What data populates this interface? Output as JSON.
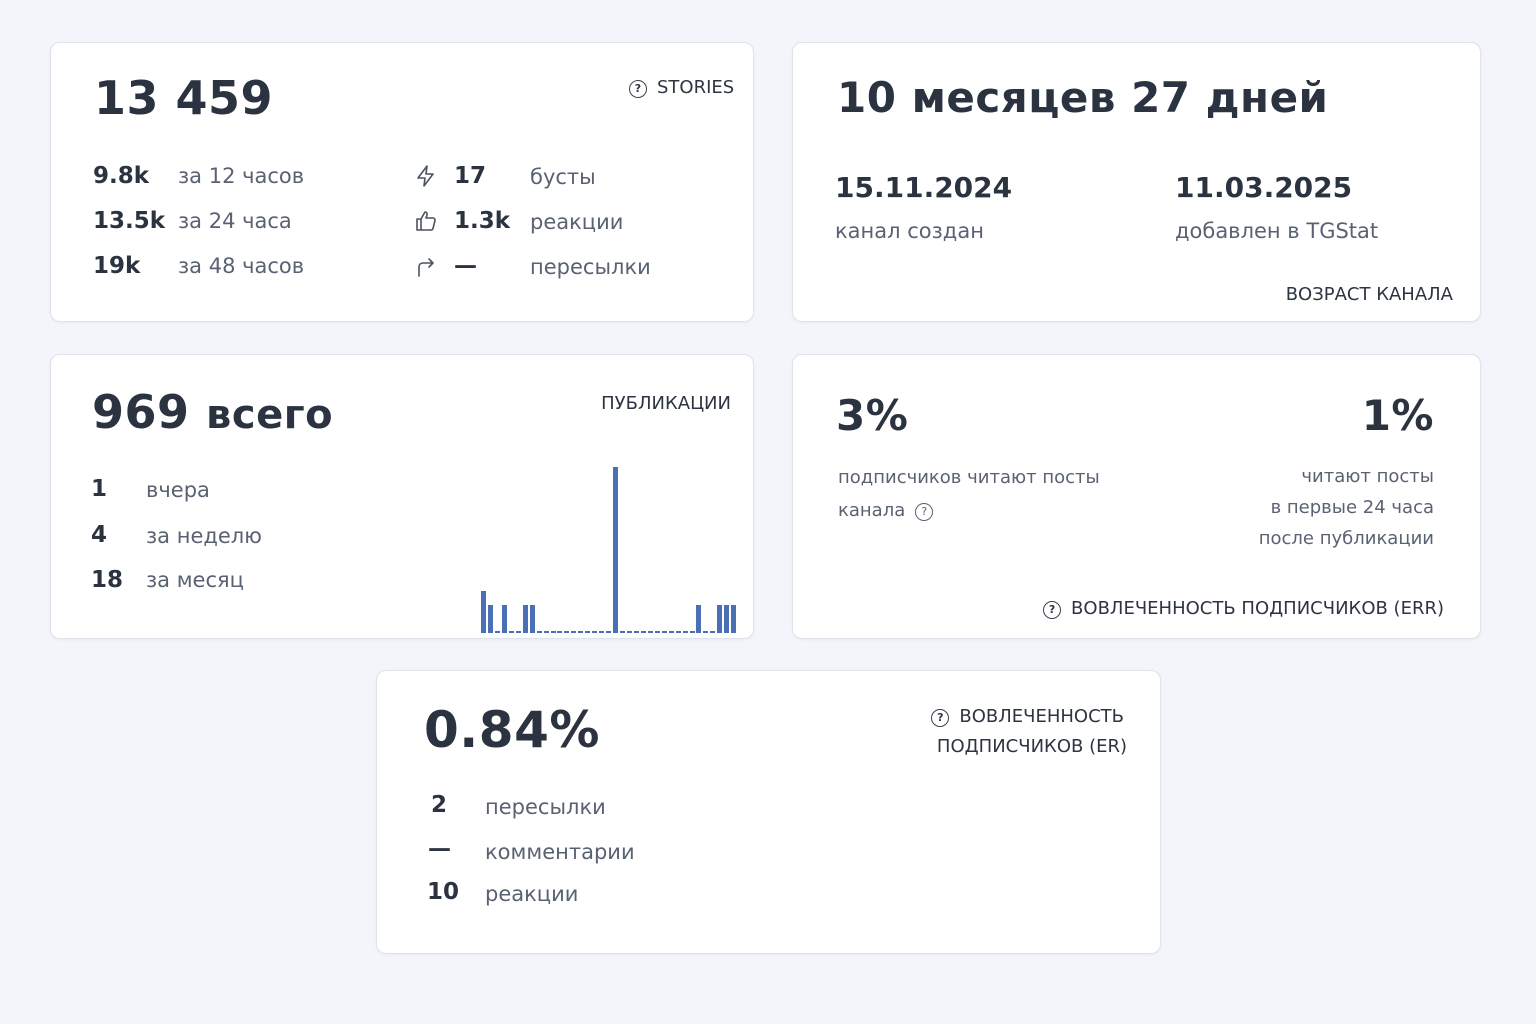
{
  "subscribers": {
    "total": "13 459",
    "tag": "STORIES",
    "growth": [
      {
        "value": "9.8k",
        "label": "за 12 часов"
      },
      {
        "value": "13.5k",
        "label": "за 24 часа"
      },
      {
        "value": "19k",
        "label": "за 48 часов"
      }
    ],
    "activity": [
      {
        "icon": "lightning-icon",
        "value": "17",
        "label": "бусты"
      },
      {
        "icon": "thumbs-up-icon",
        "value": "1.3k",
        "label": "реакции"
      },
      {
        "icon": "forward-arrow-icon",
        "value": "—",
        "label": "пересылки"
      }
    ]
  },
  "age": {
    "title": "10 месяцев 27 дней",
    "created_date": "15.11.2024",
    "created_label": "канал создан",
    "added_date": "11.03.2025",
    "added_label": "добавлен в TGStat",
    "tag": "ВОЗРАСТ КАНАЛА"
  },
  "publications": {
    "total": "969",
    "total_suffix": "всего",
    "tag": "ПУБЛИКАЦИИ",
    "stats": [
      {
        "value": "1",
        "label": "вчера"
      },
      {
        "value": "4",
        "label": "за неделю"
      },
      {
        "value": "18",
        "label": "за месяц"
      }
    ]
  },
  "chart_data": {
    "type": "bar",
    "values": [
      3,
      2,
      0,
      2,
      0,
      0,
      2,
      2,
      0,
      0,
      0,
      0,
      0,
      0,
      0,
      0,
      0,
      0,
      0,
      12,
      0,
      0,
      0,
      0,
      0,
      0,
      0,
      0,
      0,
      0,
      0,
      2,
      0,
      0,
      2,
      2,
      2
    ],
    "color": "#4a6fb5",
    "title": "",
    "xlabel": "",
    "ylabel": ""
  },
  "err": {
    "value_left": "3%",
    "label_left_line1": "подписчиков читают посты",
    "label_left_line2": "канала",
    "value_right": "1%",
    "label_right_line1": "читают посты",
    "label_right_line2": "в первые 24 часа",
    "label_right_line3": "после публикации",
    "tag": "ВОВЛЕЧЕННОСТЬ ПОДПИСЧИКОВ (ERR)"
  },
  "er": {
    "value": "0.84%",
    "tag_line1": "ВОВЛЕЧЕННОСТЬ",
    "tag_line2": "ПОДПИСЧИКОВ (ER)",
    "stats": [
      {
        "value": "2",
        "label": "пересылки"
      },
      {
        "value": "—",
        "label": "комментарии"
      },
      {
        "value": "10",
        "label": "реакции"
      }
    ]
  }
}
